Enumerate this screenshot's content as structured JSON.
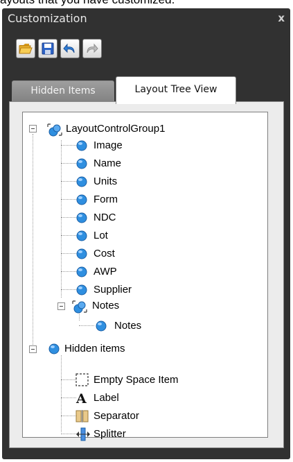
{
  "caption": "ayouts that you have customized.",
  "window": {
    "title": "Customization",
    "close": "x"
  },
  "toolbar": [
    "open-folder-icon",
    "save-icon",
    "undo-icon",
    "redo-icon"
  ],
  "tabs": [
    {
      "label": "Hidden Items",
      "active": false
    },
    {
      "label": "Layout Tree View",
      "active": true
    }
  ],
  "tree": {
    "root": {
      "label": "LayoutControlGroup1",
      "children": [
        "Image",
        "Name",
        "Units",
        "Form",
        "NDC",
        "Lot",
        "Cost",
        "AWP",
        "Supplier"
      ],
      "group": {
        "label": "Notes",
        "child": "Notes"
      }
    },
    "hidden": {
      "label": "Hidden items",
      "children": [
        {
          "label": "Empty Space Item",
          "icon": "empty-space-icon"
        },
        {
          "label": "Label",
          "icon": "label-icon"
        },
        {
          "label": "Separator",
          "icon": "separator-icon"
        },
        {
          "label": "Splitter",
          "icon": "splitter-icon"
        }
      ]
    }
  },
  "colors": {
    "window": "#313131",
    "panel": "#ececec",
    "tree_bg": "#ffffff",
    "item_icon": "#2f8fe0"
  }
}
